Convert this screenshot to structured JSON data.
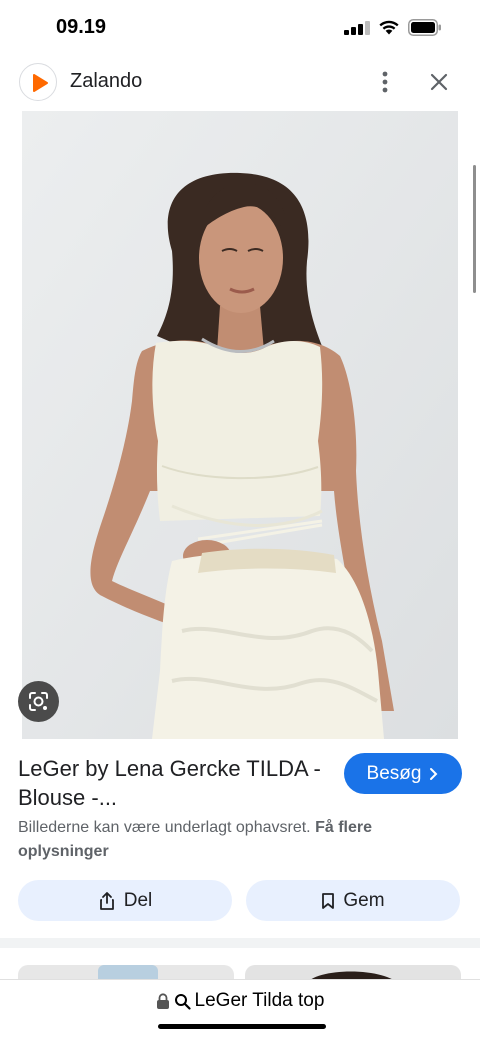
{
  "status_bar": {
    "time": "09.19"
  },
  "header": {
    "site_name": "Zalando",
    "logo_color": "#ff6900"
  },
  "product": {
    "image_alt": "Model wearing white sleeveless crop top with wrap ties and textured trousers",
    "title": "LeGer by Lena Gercke TILDA - Blouse -...",
    "visit_label": "Besøg",
    "copyright_text": "Billederne kan være underlagt ophavsret.",
    "more_info_link": "Få flere oplysninger"
  },
  "actions": {
    "share_label": "Del",
    "save_label": "Gem"
  },
  "url_bar": {
    "query": "LeGer Tilda top"
  },
  "colors": {
    "accent": "#1a73e8",
    "action_bg": "#e8f0fe"
  }
}
